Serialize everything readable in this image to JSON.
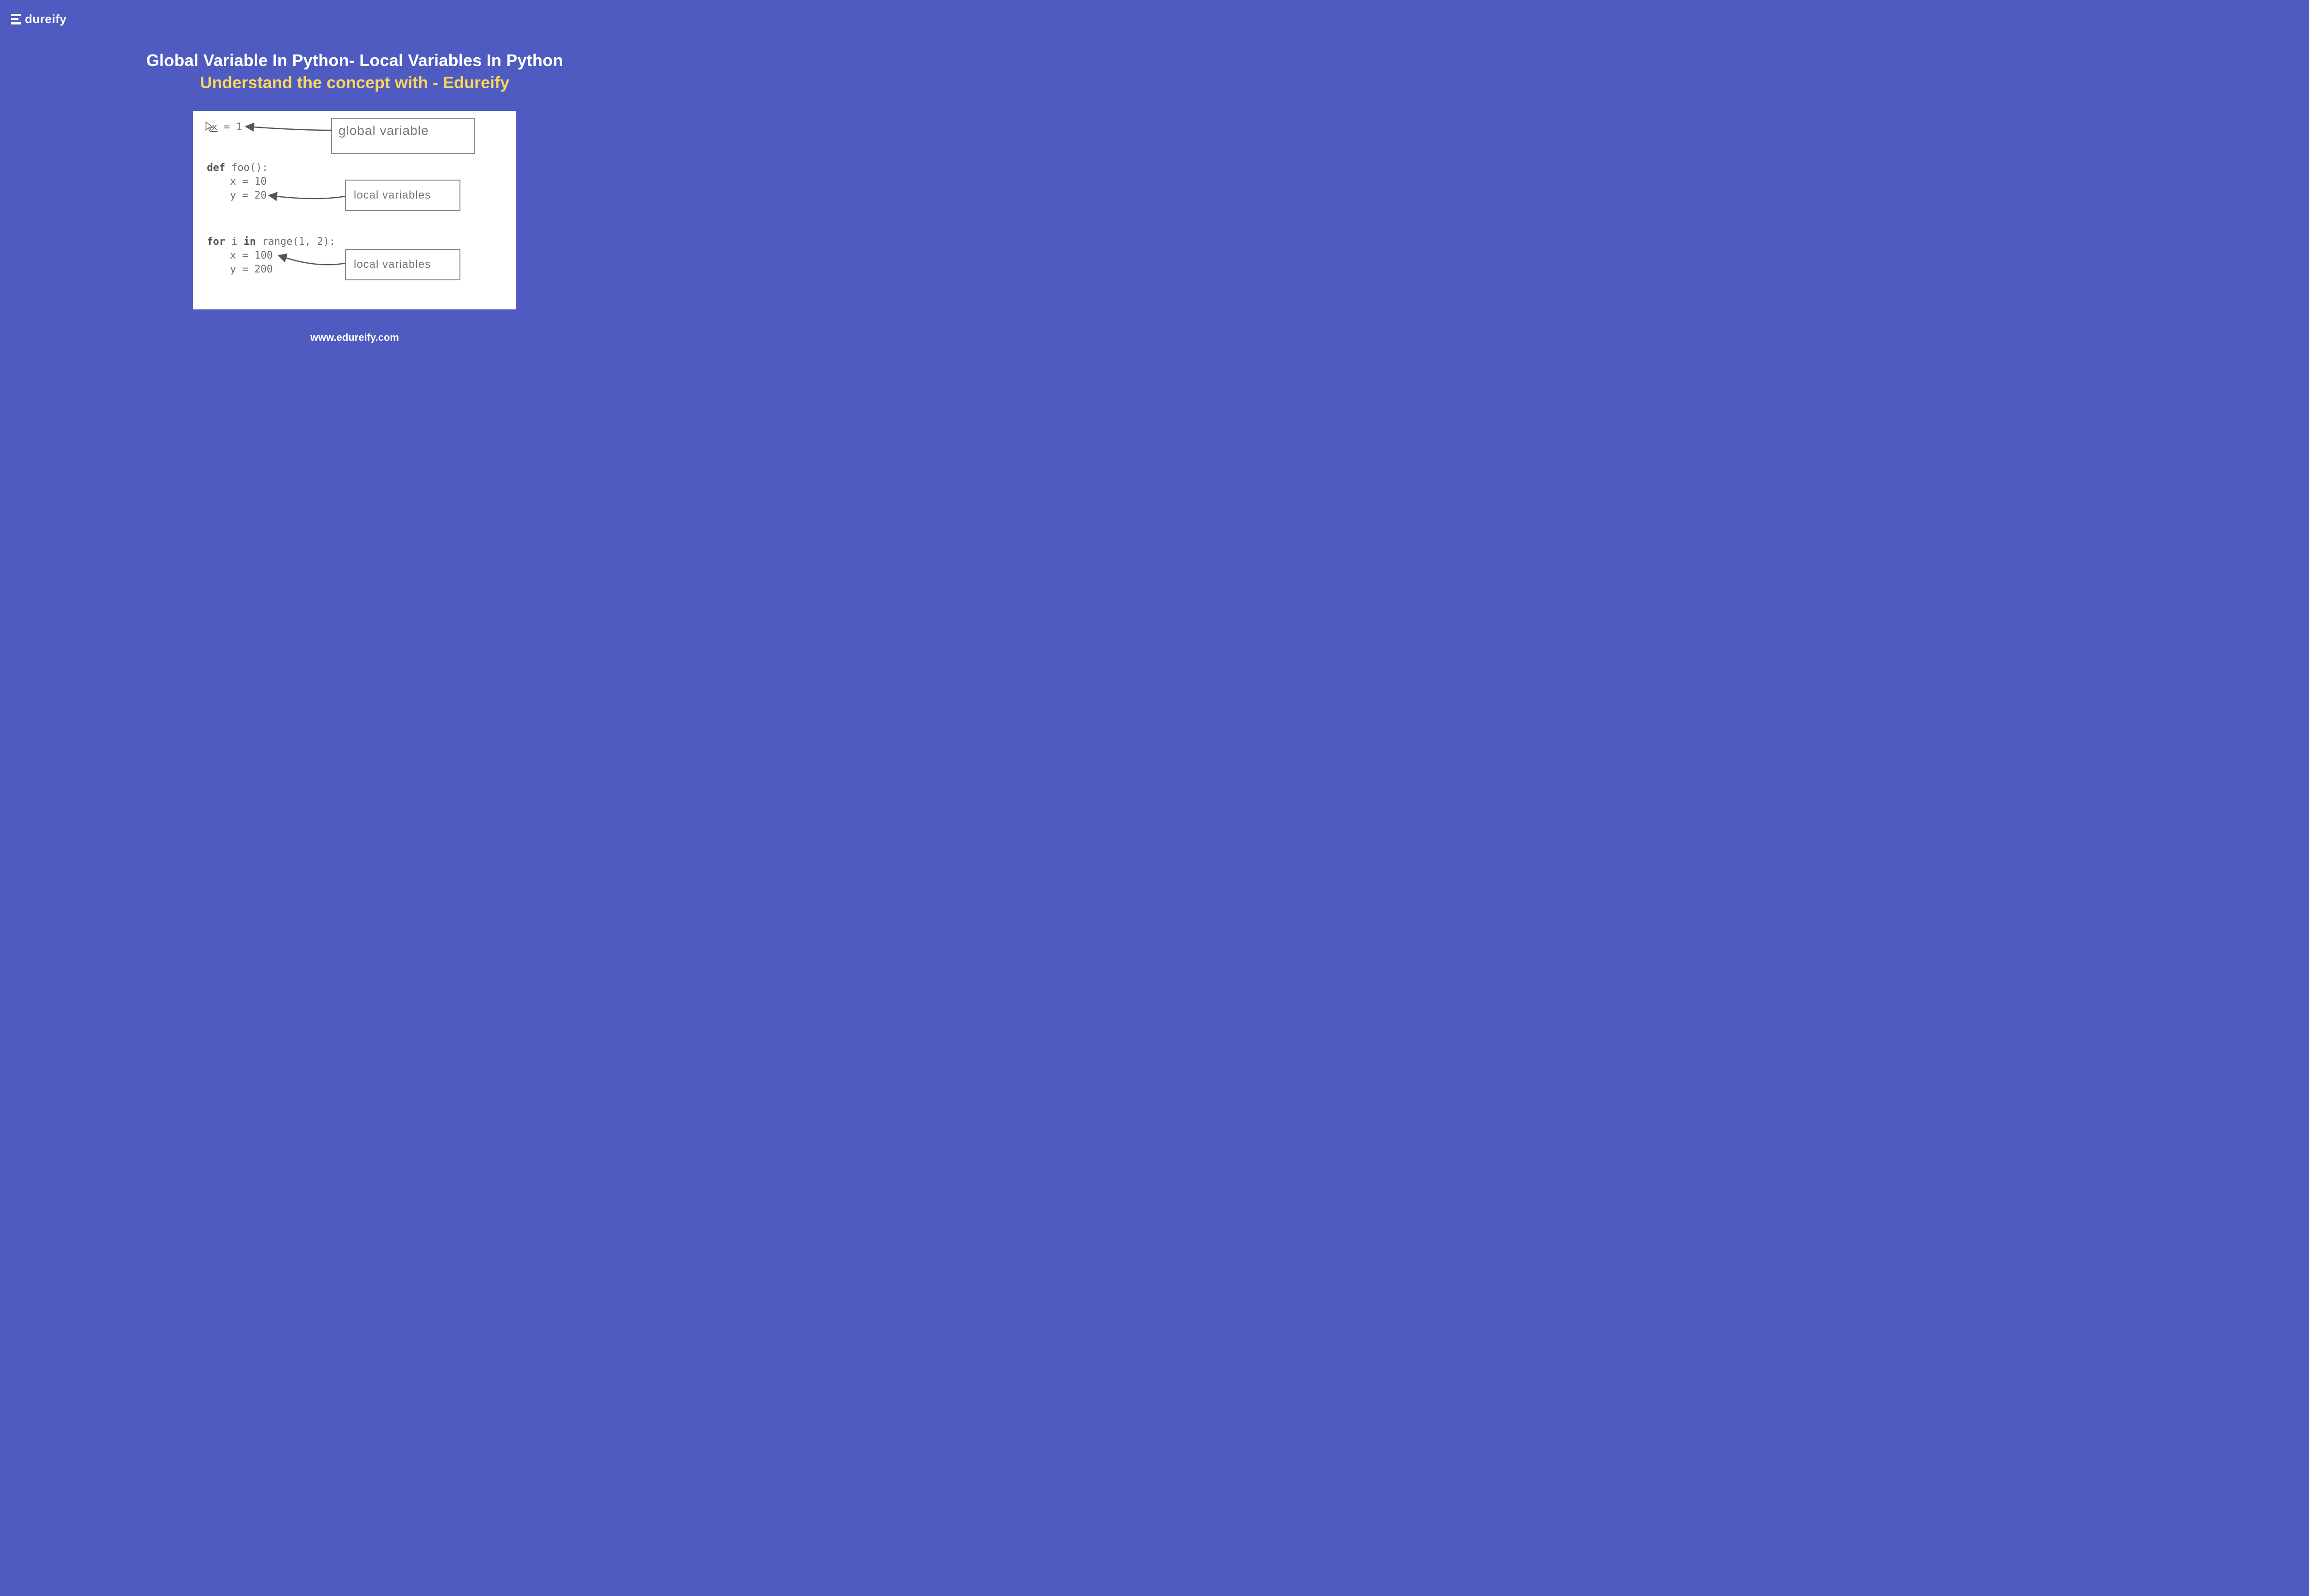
{
  "logo": {
    "text": "dureify"
  },
  "title": {
    "line1": "Global Variable In Python- Local Variables In Python",
    "line2": "Understand the concept with - Edureify"
  },
  "code": {
    "l1a": "x",
    "l1b": " = 1",
    "l2a": "def",
    "l2b": " foo():",
    "l3": "x = 10",
    "l4": "y = 20",
    "l5a": "for",
    "l5b": " i ",
    "l5c": "in",
    "l5d": " range(1, 2):",
    "l6": "x = 100",
    "l7": "y = 200"
  },
  "labels": {
    "global": "global  variable",
    "local1": "local variables",
    "local2": "local variables"
  },
  "footer": {
    "url": "www.edureify.com"
  }
}
